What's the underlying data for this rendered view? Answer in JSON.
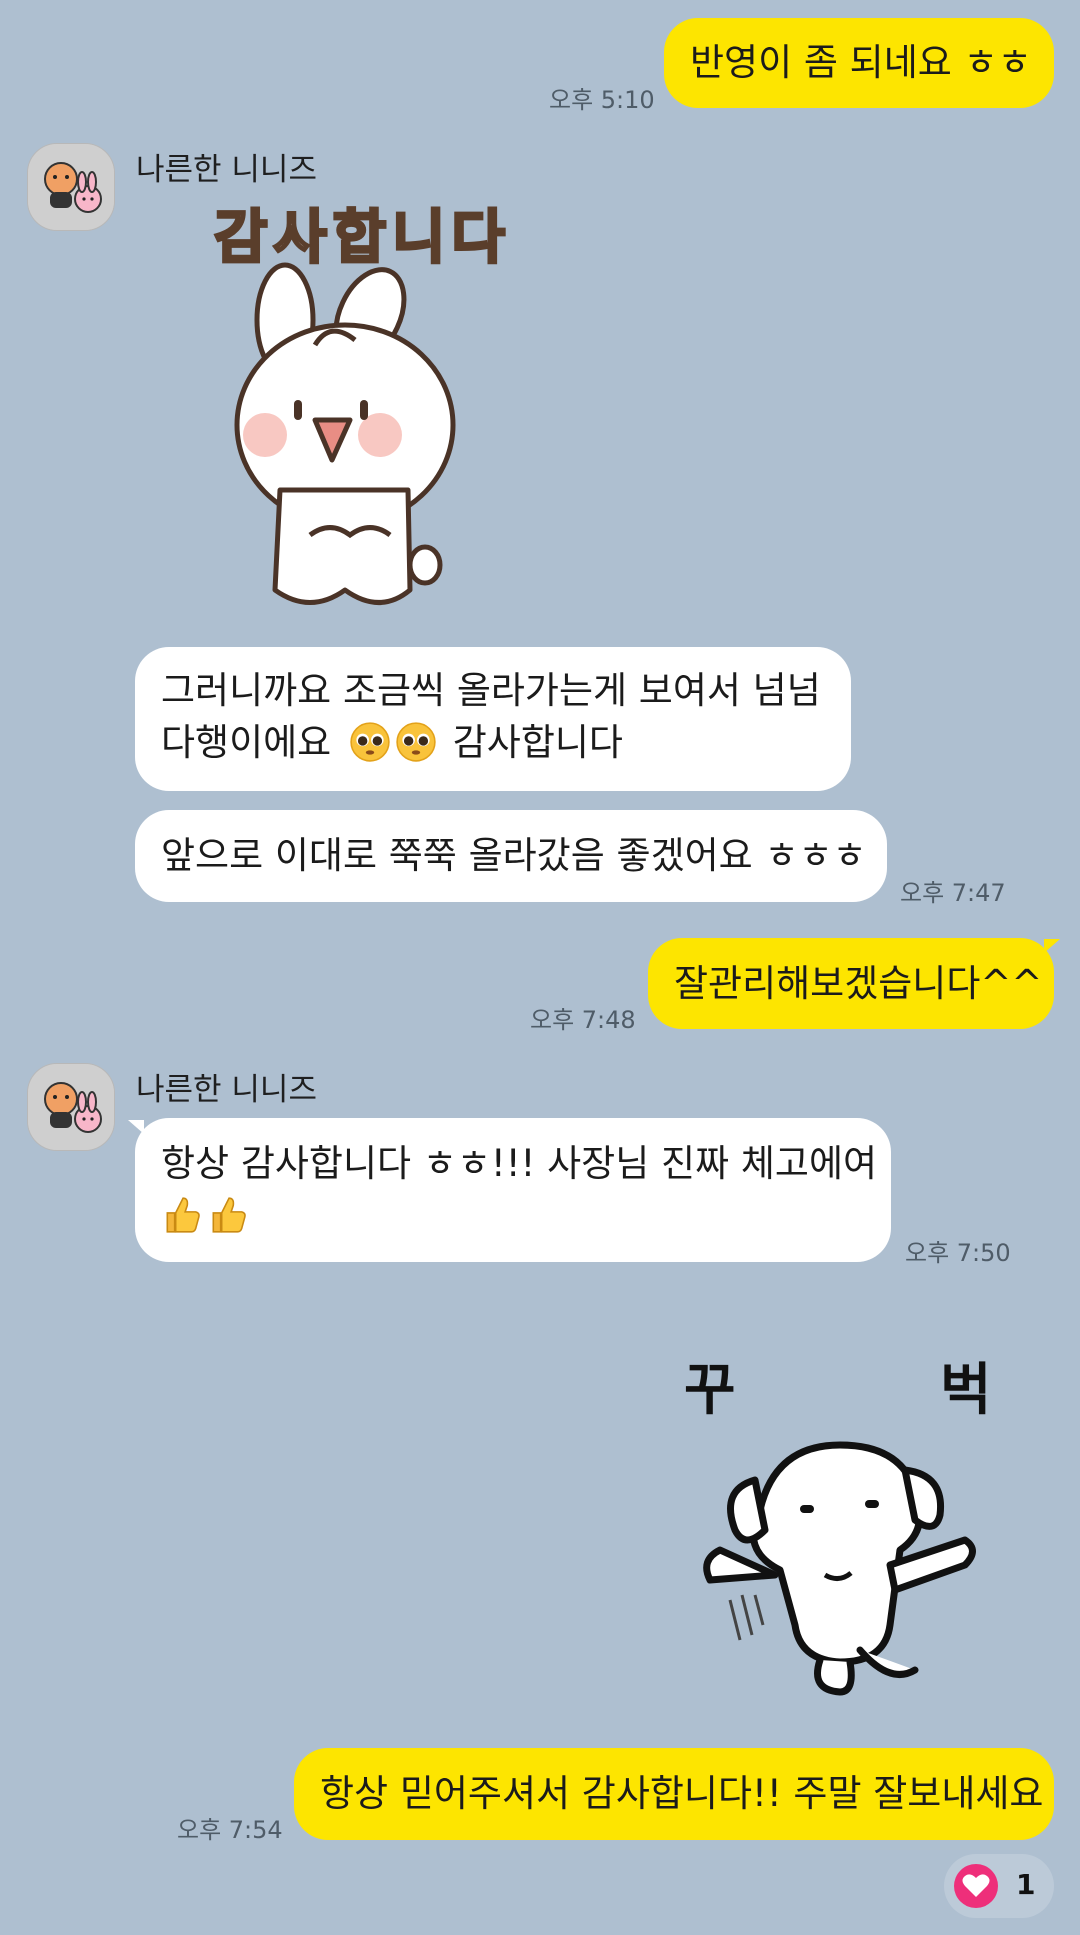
{
  "messages": {
    "m1": {
      "text": "반영이 좀 되네요 ㅎㅎ",
      "time": "오후 5:10"
    },
    "sender1": {
      "name": "나른한 니니즈"
    },
    "sticker1": {
      "caption": "감사합니다"
    },
    "m2": {
      "line1": "그러니까요 조금씩 올라가는게 보여서 넘넘",
      "line2": "다행이에요",
      "emoji": "pleading-face",
      "line2_tail": "감사합니다"
    },
    "m3": {
      "text": "앞으로 이대로 쭉쭉 올라갔음 좋겠어요 ㅎㅎㅎ",
      "time": "오후 7:47"
    },
    "m4": {
      "text": "잘관리해보겠습니다^^",
      "time": "오후 7:48"
    },
    "sender2": {
      "name": "나른한 니니즈"
    },
    "m5": {
      "line1": "항상 감사합니다 ㅎㅎ!!! 사장님 진짜 체고에여",
      "emoji": "thumbs-up",
      "time": "오후 7:50"
    },
    "sticker2": {
      "left": "꾸",
      "right": "벅"
    },
    "m6": {
      "text": "항상 믿어주셔서 감사합니다!! 주말 잘보내세요",
      "time": "오후 7:54"
    },
    "reaction": {
      "icon": "heart-icon",
      "count": "1"
    }
  },
  "colors": {
    "background": "#aebfd0",
    "mine": "#fde500",
    "theirs": "#ffffff",
    "heart": "#ee2f7a"
  }
}
